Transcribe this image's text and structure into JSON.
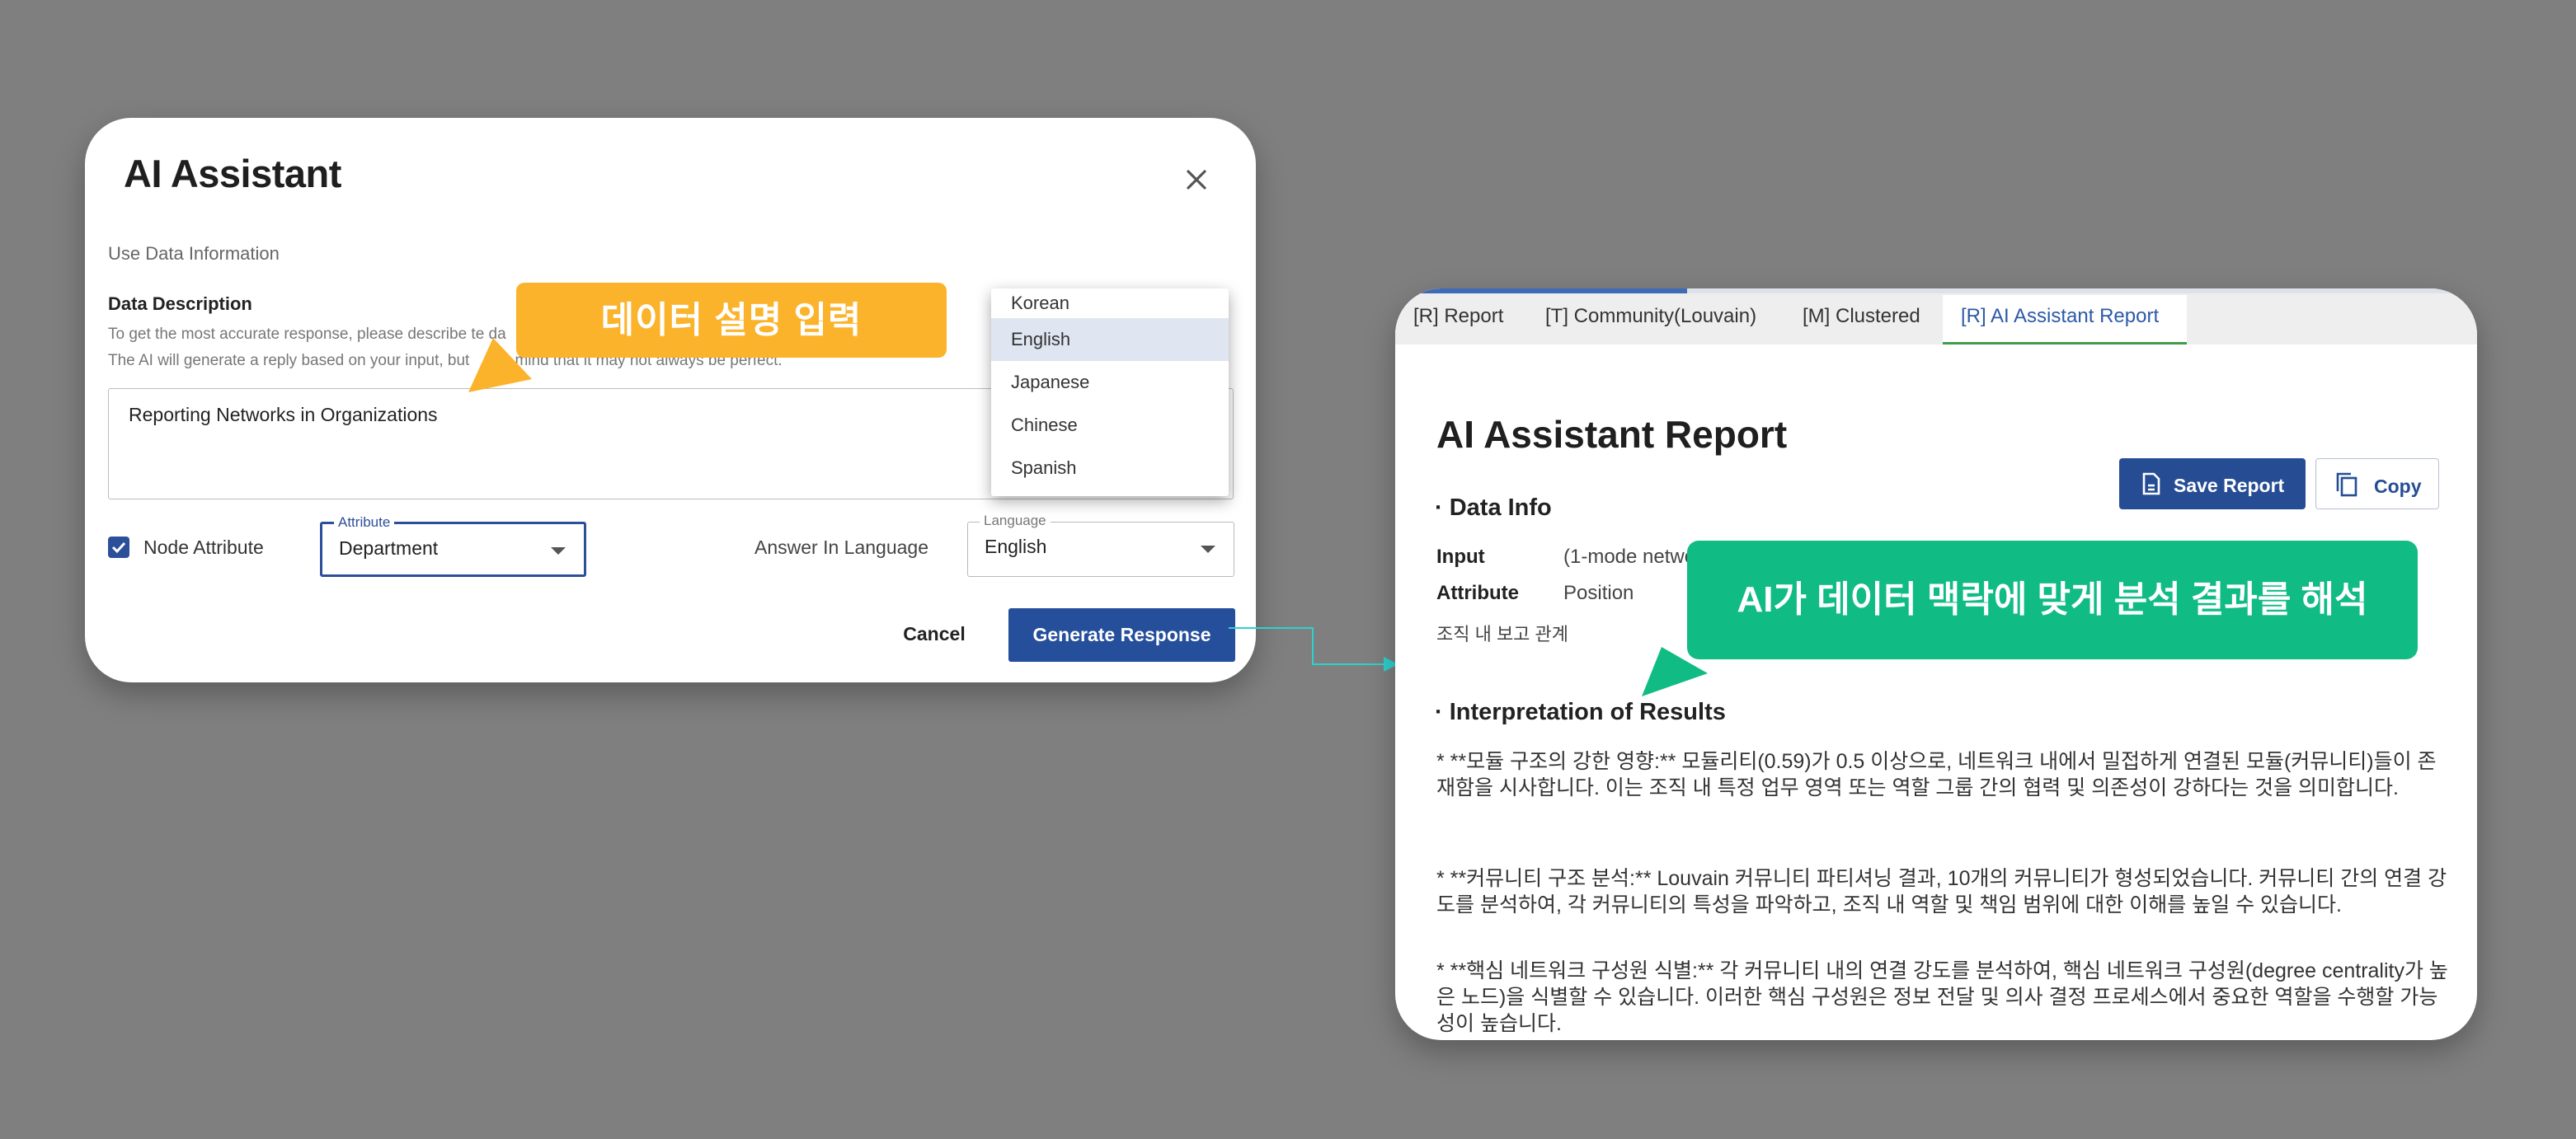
{
  "dialog": {
    "title": "AI Assistant",
    "section_label": "Use Data Information",
    "description_label": "Data Description",
    "help_line1": "To get the most accurate response, please describe t",
    "help_line2": "The AI will generate a reply based on your input, but",
    "help_line2_tail": "n mind that it may not always be perfect.",
    "help_line1_tail": "e da",
    "description_value": "Reporting Networks in Organizations",
    "node_attribute_label": "Node Attribute",
    "node_attribute_checked": true,
    "attribute_legend": "Attribute",
    "attribute_value": "Department",
    "answer_language_label": "Answer In Language",
    "language_legend": "Language",
    "language_value": "English",
    "cancel_label": "Cancel",
    "generate_label": "Generate Response",
    "language_options": [
      "Korean",
      "English",
      "Japanese",
      "Chinese",
      "Spanish"
    ],
    "selected_option": "English"
  },
  "callouts": {
    "orange": "데이터 설명 입력",
    "green": "AI가 데이터 맥락에 맞게 분석 결과를 해석"
  },
  "report": {
    "tabs": [
      "[R] Report",
      "[T] Community(Louvain)",
      "[M] Clustered",
      "[R] AI Assistant Report"
    ],
    "active_tab": "[R] AI Assistant Report",
    "title": "AI Assistant Report",
    "save_label": "Save Report",
    "copy_label": "Copy",
    "data_info_heading": "· Data Info",
    "input_key": "Input",
    "input_value": "(1-mode netwo",
    "attribute_key": "Attribute",
    "attribute_value": "Position",
    "org_note": "조직 내 보고 관계",
    "interpretation_heading": "· Interpretation of Results",
    "paragraphs": [
      "* **모듈 구조의 강한 영향:** 모듈리티(0.59)가 0.5 이상으로, 네트워크 내에서 밀접하게 연결된 모듈(커뮤니티)들이 존재함을 시사합니다. 이는 조직 내 특정 업무 영역 또는 역할 그룹 간의 협력 및 의존성이 강하다는 것을 의미합니다.",
      "* **커뮤니티 구조 분석:** Louvain 커뮤니티 파티셔닝 결과, 10개의 커뮤니티가 형성되었습니다. 커뮤니티 간의 연결 강도를 분석하여, 각 커뮤니티의 특성을 파악하고, 조직 내 역할 및 책임 범위에 대한 이해를 높일 수 있습니다.",
      "* **핵심 네트워크 구성원 식별:** 각 커뮤니티 내의 연결 강도를 분석하여, 핵심 네트워크 구성원(degree centrality가 높은 노드)을 식별할 수 있습니다. 이러한 핵심 구성원은 정보 전달 및 의사 결정 프로세스에서 중요한 역할을 수행할 가능성이 높습니다."
    ]
  },
  "colors": {
    "background": "#7f7f7f",
    "primary_blue": "#254e9b",
    "orange": "#fbb32b",
    "green": "#11bb84",
    "active_tab_underline": "#3e9c4a"
  }
}
